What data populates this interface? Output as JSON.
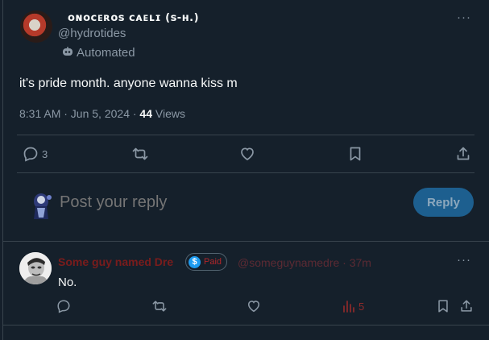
{
  "tweet": {
    "display_name": "ᴏɴᴏᴄᴇʀᴏꜱ ᴄᴀᴇʟɪ (ꜱ-ʜ.)",
    "handle": "@hydrotides",
    "label": "Automated",
    "text": "it's pride month. anyone wanna kiss m",
    "time": "8:31 AM · Jun 5, 2024 · ",
    "views_count": "44",
    "views_label": " Views",
    "more": "···",
    "actions": {
      "reply_count": "3"
    }
  },
  "composer": {
    "placeholder": "Post your reply",
    "button": "Reply"
  },
  "reply": {
    "display_name": "Some guy named Dre",
    "badge_symbol": "$",
    "badge_label": "Paid",
    "handle_time": "@someguynamedre · 37m",
    "text": "No.",
    "more": "···",
    "views_count": "5"
  },
  "colors": {
    "background": "#15202b",
    "accent": "#1d9bf0",
    "reply_button": "#1d5f8f",
    "dre_name": "#7a1c1c"
  }
}
